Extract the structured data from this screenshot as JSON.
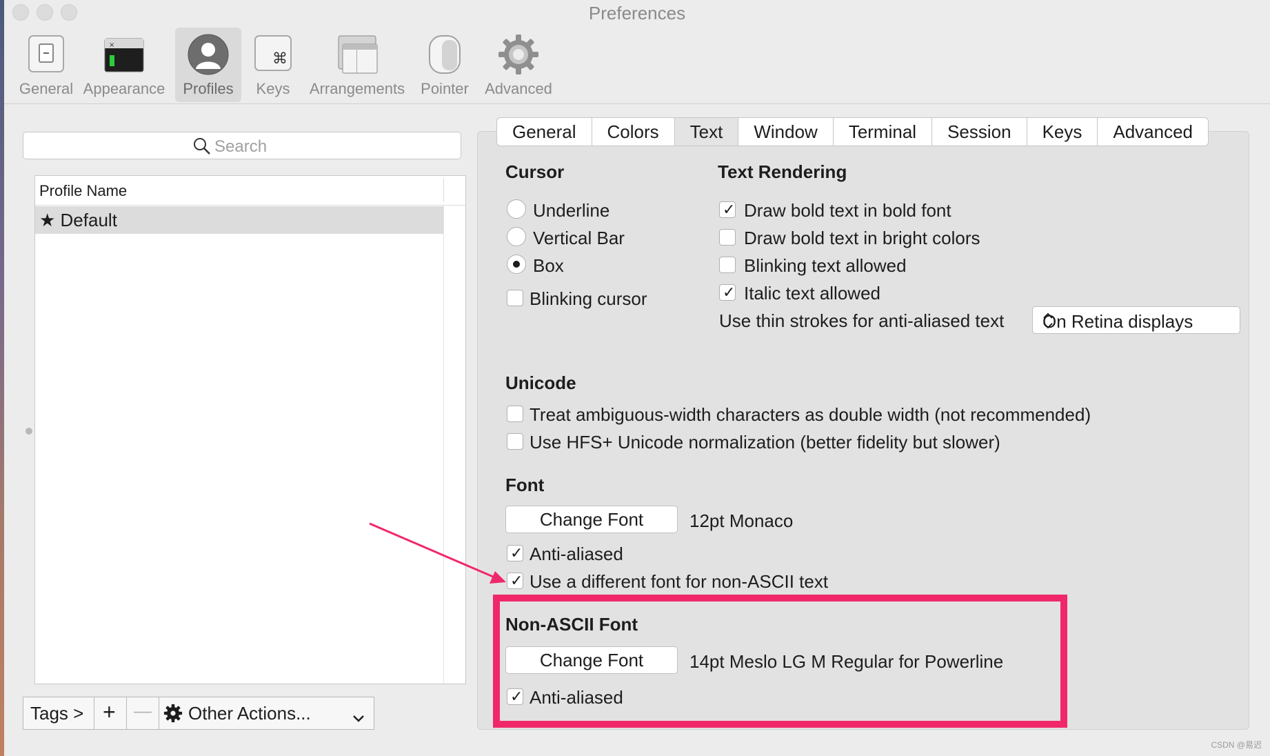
{
  "window": {
    "title": "Preferences"
  },
  "toolbar": {
    "items": [
      {
        "label": "General",
        "icon": "general-switch-icon"
      },
      {
        "label": "Appearance",
        "icon": "appearance-terminal-icon"
      },
      {
        "label": "Profiles",
        "icon": "profiles-person-icon"
      },
      {
        "label": "Keys",
        "icon": "keys-command-icon"
      },
      {
        "label": "Arrangements",
        "icon": "arrangements-windows-icon"
      },
      {
        "label": "Pointer",
        "icon": "pointer-mouse-icon"
      },
      {
        "label": "Advanced",
        "icon": "advanced-gear-icon"
      }
    ],
    "selected": "Profiles"
  },
  "sidebar": {
    "search_placeholder": "Search",
    "column_header": "Profile Name",
    "profiles": [
      {
        "label": "★ Default",
        "selected": true
      }
    ],
    "bottom_bar": {
      "tags_label": "Tags >",
      "add_label": "+",
      "remove_label": "—",
      "other_actions_label": "Other Actions..."
    }
  },
  "tabs": {
    "items": [
      "General",
      "Colors",
      "Text",
      "Window",
      "Terminal",
      "Session",
      "Keys",
      "Advanced"
    ],
    "selected": "Text"
  },
  "cursor": {
    "heading": "Cursor",
    "options": [
      {
        "label": "Underline",
        "checked": false
      },
      {
        "label": "Vertical Bar",
        "checked": false
      },
      {
        "label": "Box",
        "checked": true
      }
    ],
    "blinking_label": "Blinking cursor",
    "blinking_checked": false
  },
  "text_rendering": {
    "heading": "Text Rendering",
    "options": [
      {
        "label": "Draw bold text in bold font",
        "checked": true
      },
      {
        "label": "Draw bold text in bright colors",
        "checked": false
      },
      {
        "label": "Blinking text allowed",
        "checked": false
      },
      {
        "label": "Italic text allowed",
        "checked": true
      }
    ],
    "thin_strokes_label": "Use thin strokes for anti-aliased text",
    "thin_strokes_value": "On Retina displays"
  },
  "unicode": {
    "heading": "Unicode",
    "options": [
      {
        "label": "Treat ambiguous-width characters as double width (not recommended)",
        "checked": false
      },
      {
        "label": "Use HFS+ Unicode normalization (better fidelity but slower)",
        "checked": false
      }
    ]
  },
  "font": {
    "heading": "Font",
    "change_font_label": "Change Font",
    "current_font": "12pt Monaco",
    "anti_aliased_label": "Anti-aliased",
    "anti_aliased_checked": true,
    "non_ascii_toggle_label": "Use a different font for non-ASCII text",
    "non_ascii_toggle_checked": true
  },
  "non_ascii_font": {
    "heading": "Non-ASCII Font",
    "change_font_label": "Change Font",
    "current_font": "14pt Meslo LG M Regular for Powerline",
    "anti_aliased_label": "Anti-aliased",
    "anti_aliased_checked": true
  },
  "annotation": {
    "highlight_color": "#f0286a"
  },
  "watermark": "CSDN @易迟"
}
